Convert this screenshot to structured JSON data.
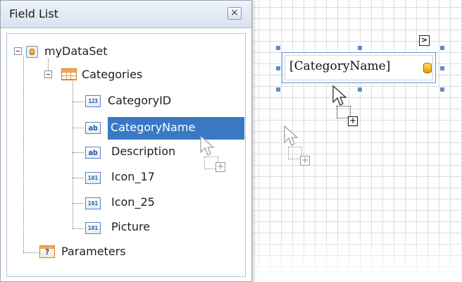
{
  "panel": {
    "title": "Field List",
    "close_label": "×"
  },
  "tree": {
    "dataset": {
      "label": "myDataSet",
      "icon": "dataset-icon"
    },
    "table": {
      "label": "Categories",
      "icon": "table-icon"
    },
    "fields": [
      {
        "label": "CategoryID",
        "type_glyph": "123",
        "icon": "numeric-field-icon"
      },
      {
        "label": "CategoryName",
        "type_glyph": "ab",
        "icon": "string-field-icon",
        "selected": true
      },
      {
        "label": "Description",
        "type_glyph": "ab",
        "icon": "string-field-icon"
      },
      {
        "label": "Icon_17",
        "type_glyph": "101",
        "icon": "binary-field-icon"
      },
      {
        "label": "Icon_25",
        "type_glyph": "101",
        "icon": "binary-field-icon"
      },
      {
        "label": "Picture",
        "type_glyph": "101",
        "icon": "binary-field-icon"
      }
    ],
    "parameters": {
      "label": "Parameters",
      "glyph": "?",
      "icon": "parameters-icon"
    }
  },
  "designer": {
    "field_control_text": "[CategoryName]",
    "smart_tag_label": ">",
    "drop_plus": "+"
  },
  "colors": {
    "selection": "#3979c4",
    "handle": "#5b8fd0",
    "panel_header": "#d8e2ef"
  }
}
